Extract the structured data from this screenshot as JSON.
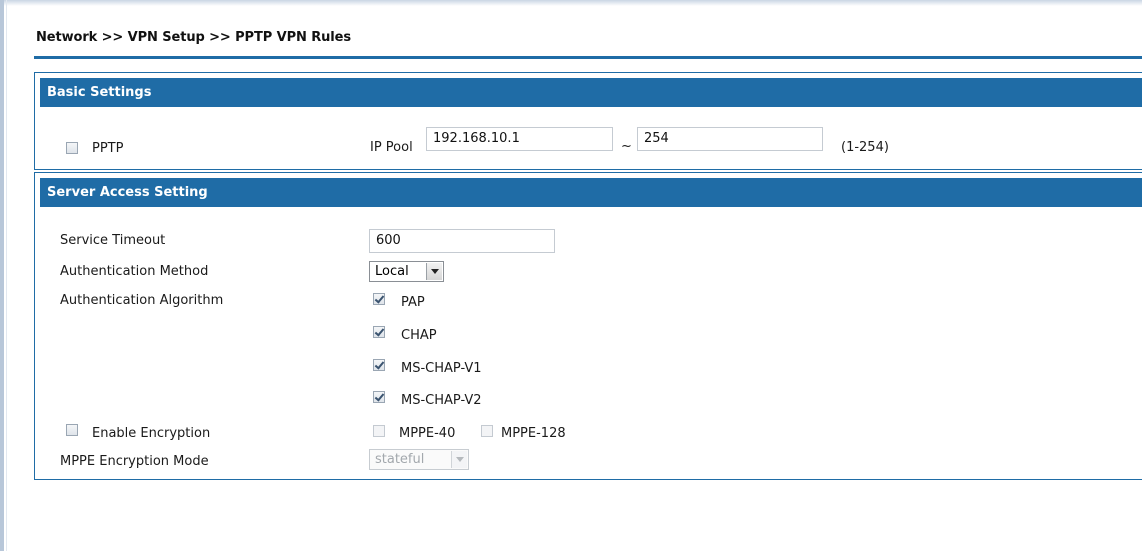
{
  "breadcrumb": "Network >> VPN Setup >> PPTP VPN Rules",
  "basic": {
    "header": "Basic Settings",
    "pptp_label": "PPTP",
    "pptp_checked": false,
    "ip_pool_label": "IP Pool",
    "ip_pool_start": "192.168.10.1",
    "tilde": "~",
    "ip_pool_end": "254",
    "range_hint": "(1-254)"
  },
  "server": {
    "header": "Server Access Setting",
    "service_timeout_label": "Service Timeout",
    "service_timeout_value": "600",
    "auth_method_label": "Authentication Method",
    "auth_method_value": "Local",
    "auth_algorithm_label": "Authentication Algorithm",
    "algorithms": [
      {
        "label": "PAP",
        "checked": true
      },
      {
        "label": "CHAP",
        "checked": true
      },
      {
        "label": "MS-CHAP-V1",
        "checked": true
      },
      {
        "label": "MS-CHAP-V2",
        "checked": true
      }
    ],
    "enable_encryption_label": "Enable Encryption",
    "enable_encryption_checked": false,
    "mppe40_label": "MPPE-40",
    "mppe128_label": "MPPE-128",
    "mppe_mode_label": "MPPE Encryption Mode",
    "mppe_mode_value": "stateful"
  },
  "colors": {
    "accent": "#1f6ca6",
    "header_text": "#ffffff"
  }
}
